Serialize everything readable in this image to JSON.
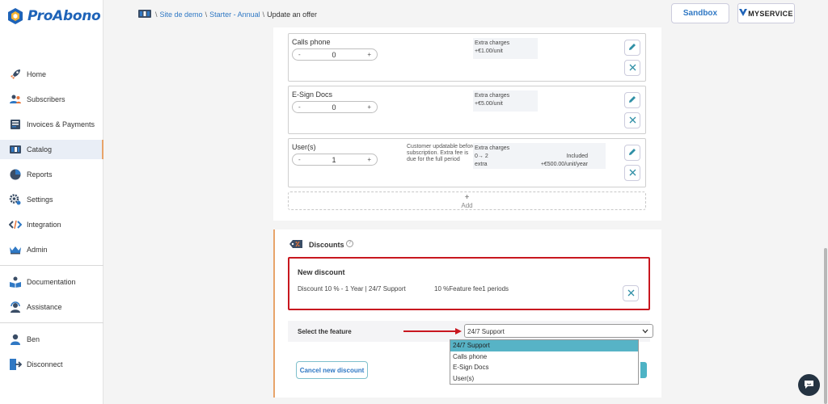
{
  "logo": {
    "text": "ProAbono"
  },
  "nav": [
    {
      "label": "Home",
      "icon": "rocket-icon"
    },
    {
      "label": "Subscribers",
      "icon": "users-icon"
    },
    {
      "label": "Invoices & Payments",
      "icon": "invoice-icon"
    },
    {
      "label": "Catalog",
      "icon": "catalog-icon"
    },
    {
      "label": "Reports",
      "icon": "pie-chart-icon"
    },
    {
      "label": "Settings",
      "icon": "gear-icon"
    },
    {
      "label": "Integration",
      "icon": "code-icon"
    },
    {
      "label": "Admin",
      "icon": "crown-icon"
    },
    {
      "label": "Documentation",
      "icon": "book-icon"
    },
    {
      "label": "Assistance",
      "icon": "headset-icon"
    },
    {
      "label": "Ben",
      "icon": "user-icon"
    },
    {
      "label": "Disconnect",
      "icon": "logout-icon"
    }
  ],
  "breadcrumb": {
    "sep": "\\",
    "site": "Site de demo",
    "plan": "Starter - Annual",
    "current": "Update an offer"
  },
  "header": {
    "sandbox": "Sandbox",
    "brand": "MYSERVICE"
  },
  "features": [
    {
      "name": "Calls phone",
      "value": "0",
      "minus": "-",
      "plus": "+",
      "note": "",
      "charges_label": "Extra charges",
      "charges_lines": [
        "+€1.00/unit"
      ],
      "tier_label": "",
      "tier_value": ""
    },
    {
      "name": "E-Sign Docs",
      "value": "0",
      "minus": "-",
      "plus": "+",
      "note": "",
      "charges_label": "Extra charges",
      "charges_lines": [
        "+€5.00/unit"
      ],
      "tier_label": "",
      "tier_value": ""
    },
    {
      "name": "User(s)",
      "value": "1",
      "minus": "-",
      "plus": "+",
      "note": "Customer updatable before subscription. Extra fee is due for the full period",
      "charges_label": "Extra charges",
      "charges_lines": [
        "0→ 2",
        "extra"
      ],
      "tier_label": "Included",
      "tier_value": "+€500.00/unit/year"
    }
  ],
  "add": {
    "plus": "+",
    "label": "Add"
  },
  "discounts": {
    "title": "Discounts",
    "help": "?",
    "new_title": "New discount",
    "new_desc": "Discount 10 % - 1 Year | 24/7 Support",
    "new_value": "10 %Feature fee1 periods",
    "select_label": "Select the feature",
    "selected": "24/7 Support",
    "options": [
      "24/7 Support",
      "Calls phone",
      "E-Sign Docs",
      "User(s)"
    ],
    "cancel": "Cancel new discount"
  },
  "colors": {
    "accent": "#2f78c4",
    "highlight": "#c8171f",
    "select": "#57b3c6",
    "active_border": "#e8a46a"
  }
}
